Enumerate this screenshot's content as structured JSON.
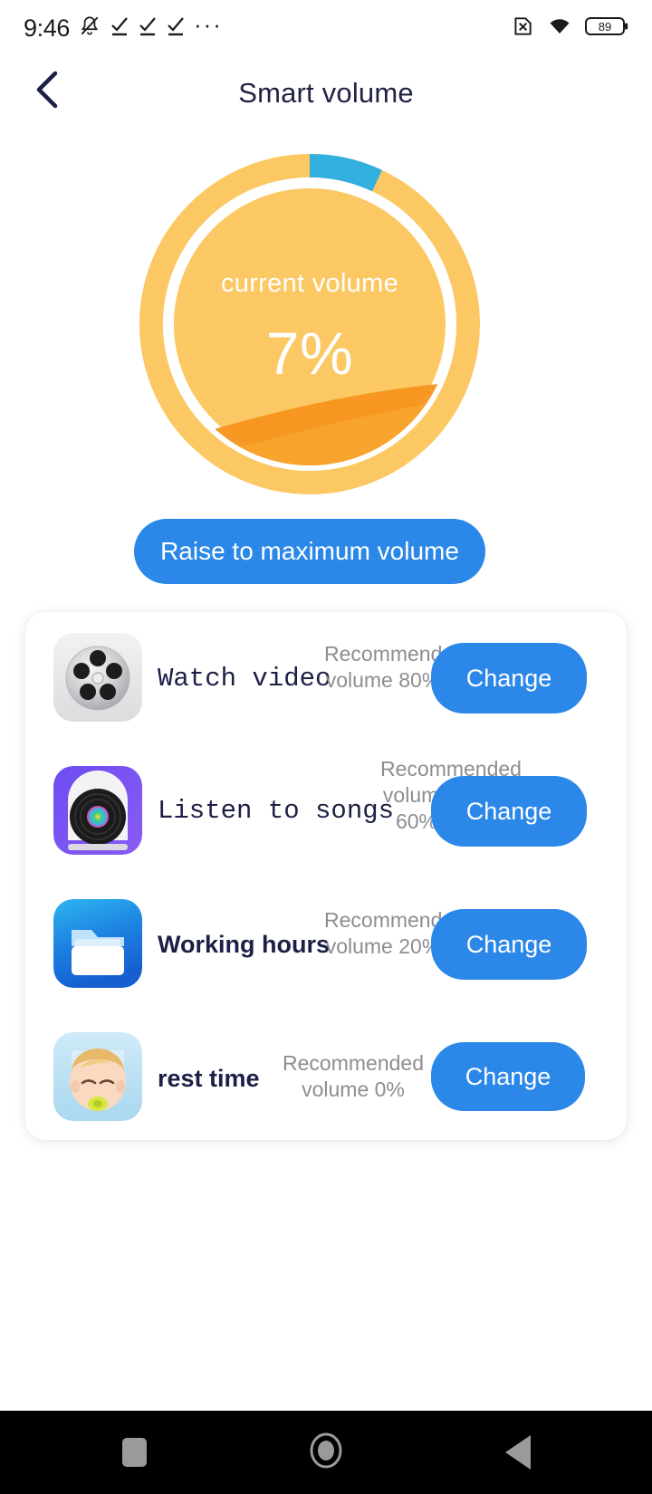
{
  "status_bar": {
    "clock": "9:46",
    "battery_percent": "89",
    "icons": [
      "mute-bell-icon",
      "check-underline-icon",
      "check-underline-icon",
      "check-underline-icon",
      "overflow-dots-icon",
      "sim-x-icon",
      "wifi-icon",
      "battery-icon"
    ],
    "dots": "···"
  },
  "header": {
    "title": "Smart volume",
    "back_icon": "chevron-left-icon"
  },
  "gauge": {
    "caption": "current volume",
    "value": "7%",
    "percent": 7,
    "ring_color": "#fbc863",
    "progress_color": "#31afdf",
    "inner_fill": "#fbc863",
    "wave_color": "#f7941e",
    "gap_color": "#ffffff",
    "text_color": "#ffffff"
  },
  "primary_action": {
    "label": "Raise to maximum volume",
    "color": "#2b87e8"
  },
  "scenes": {
    "change_label": "Change",
    "items": [
      {
        "title": "Watch video",
        "recommendation": "Recommended volume 80%",
        "recommended_percent": "80%",
        "icon": "film-reel-icon",
        "title_style": "mono"
      },
      {
        "title": "Listen to songs",
        "recommendation": "Recommended volume 60%",
        "recommended_percent": "60%",
        "icon": "vinyl-record-icon",
        "title_style": "mono"
      },
      {
        "title": "Working hours",
        "recommendation": "Recommended volume 20%",
        "recommended_percent": "20%",
        "icon": "folder-icon",
        "title_style": "sans"
      },
      {
        "title": "rest time",
        "recommendation": "Recommended volume 0%",
        "recommended_percent": "0%",
        "icon": "sleeping-baby-icon",
        "title_style": "sans"
      }
    ]
  },
  "nav_bar": {
    "recents_icon": "square-icon",
    "home_icon": "circle-icon",
    "back_icon": "triangle-left-icon",
    "background": "#000000",
    "icon_color": "#9a9a9a"
  }
}
